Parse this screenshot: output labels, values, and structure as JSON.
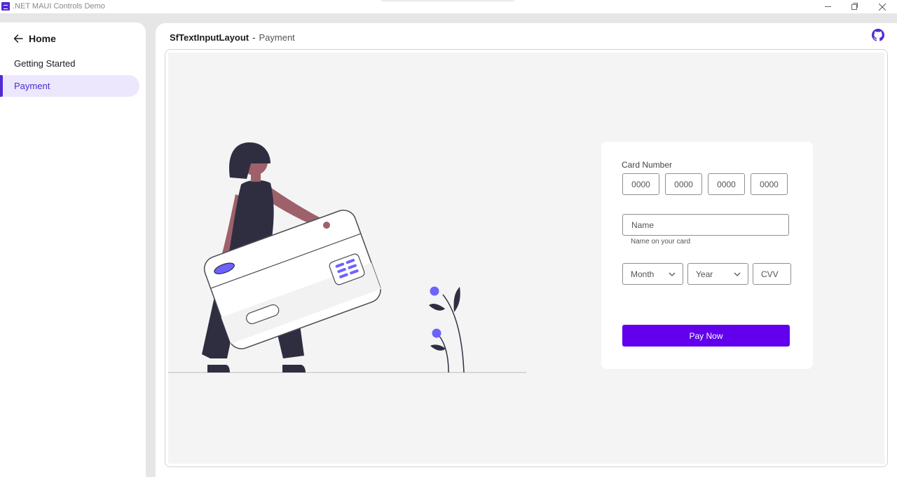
{
  "window": {
    "title": ".NET MAUI Controls Demo"
  },
  "sidebar": {
    "home_label": "Home",
    "items": [
      {
        "label": "Getting Started"
      },
      {
        "label": "Payment"
      }
    ]
  },
  "header": {
    "control_name": "SfTextInputLayout",
    "separator": "-",
    "sample_name": "Payment"
  },
  "form": {
    "card_number_label": "Card Number",
    "card_number_segments": [
      "0000",
      "0000",
      "0000",
      "0000"
    ],
    "name_placeholder": "Name",
    "name_helper": "Name on your card",
    "month_placeholder": "Month",
    "year_placeholder": "Year",
    "cvv_placeholder": "CVV",
    "pay_button": "Pay Now"
  },
  "colors": {
    "accent": "#512bd4",
    "selected_nav_bg": "#ede7fd",
    "pay_button": "#6200ee",
    "illustration_purple": "#6c63ff",
    "illustration_dark": "#2f2e41",
    "illustration_skin": "#9e616a"
  }
}
